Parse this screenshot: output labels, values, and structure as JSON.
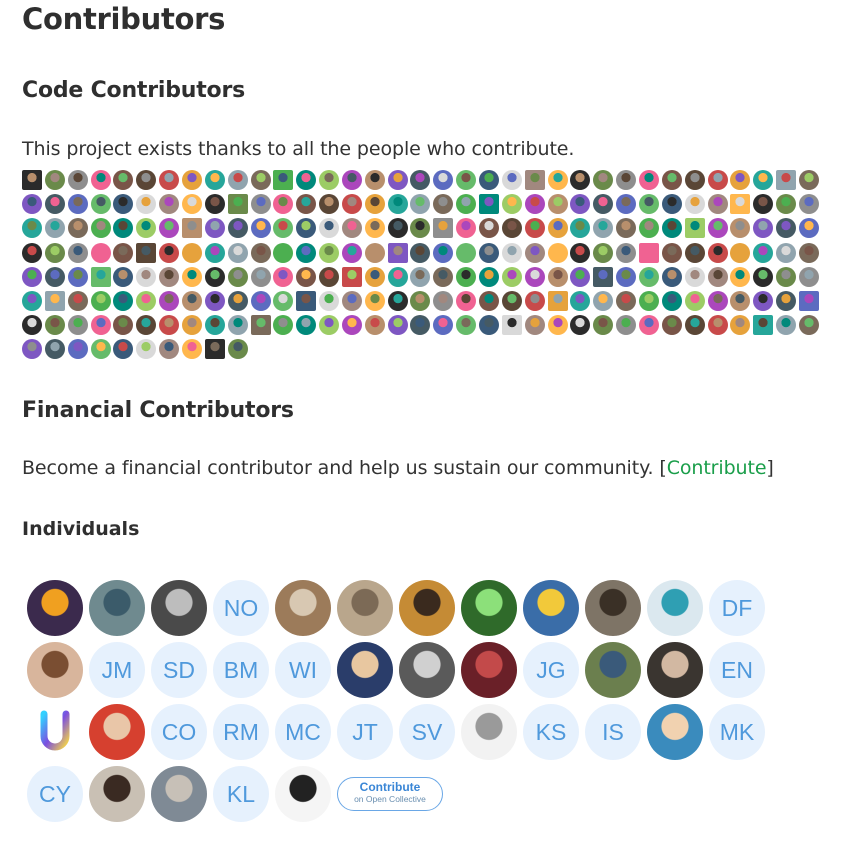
{
  "page": {
    "title": "Contributors",
    "code_section": {
      "heading": "Code Contributors",
      "text": "This project exists thanks to all the people who contribute."
    },
    "financial_section": {
      "heading": "Financial Contributors",
      "text_before": "Become a financial contributor and help us sustain our community. [",
      "link_label": "Contribute",
      "text_after": "]"
    },
    "individuals_heading": "Individuals"
  },
  "code_contributors_count": 255,
  "backers": [
    {
      "kind": "photo",
      "color": "#3b2a4d",
      "accent": "#f0a020"
    },
    {
      "kind": "photo",
      "color": "#6f8a8f",
      "accent": "#3b5b6a"
    },
    {
      "kind": "photo",
      "color": "#4a4a4a",
      "accent": "#bdbdbd"
    },
    {
      "kind": "initials",
      "label": "NO"
    },
    {
      "kind": "photo",
      "color": "#9c7b5a",
      "accent": "#d8c8b2"
    },
    {
      "kind": "photo",
      "color": "#b9a68c",
      "accent": "#7c6a56"
    },
    {
      "kind": "photo",
      "color": "#c58b35",
      "accent": "#3a2a1e"
    },
    {
      "kind": "photo",
      "color": "#2f6a2a",
      "accent": "#8ce07a"
    },
    {
      "kind": "photo",
      "color": "#3a6da8",
      "accent": "#f2c93a"
    },
    {
      "kind": "photo",
      "color": "#7e7466",
      "accent": "#3a3026"
    },
    {
      "kind": "photo",
      "color": "#dbe8ef",
      "accent": "#2f9fb3"
    },
    {
      "kind": "initials",
      "label": "DF"
    },
    {
      "kind": "photo",
      "color": "#d8b59c",
      "accent": "#7a4e32"
    },
    {
      "kind": "initials",
      "label": "JM"
    },
    {
      "kind": "initials",
      "label": "SD"
    },
    {
      "kind": "initials",
      "label": "BM"
    },
    {
      "kind": "initials",
      "label": "WI"
    },
    {
      "kind": "photo",
      "color": "#2a3d6a",
      "accent": "#e8c7a0"
    },
    {
      "kind": "photo",
      "color": "#5a5a5a",
      "accent": "#d0d0d0"
    },
    {
      "kind": "photo",
      "color": "#6a2028",
      "accent": "#c34a4a"
    },
    {
      "kind": "initials",
      "label": "JG"
    },
    {
      "kind": "photo",
      "color": "#6b7f4e",
      "accent": "#3a5a7a"
    },
    {
      "kind": "photo",
      "color": "#3a3530",
      "accent": "#d2b8a2"
    },
    {
      "kind": "initials",
      "label": "EN"
    },
    {
      "kind": "logo-u",
      "color": "#ffffff",
      "accent": "#7b4ee0"
    },
    {
      "kind": "photo",
      "color": "#d6402f",
      "accent": "#e9c6a8"
    },
    {
      "kind": "initials",
      "label": "CO"
    },
    {
      "kind": "initials",
      "label": "RM"
    },
    {
      "kind": "initials",
      "label": "MC"
    },
    {
      "kind": "initials",
      "label": "JT"
    },
    {
      "kind": "initials",
      "label": "SV"
    },
    {
      "kind": "photo",
      "color": "#f2f2f2",
      "accent": "#9a9a9a"
    },
    {
      "kind": "initials",
      "label": "KS"
    },
    {
      "kind": "initials",
      "label": "IS"
    },
    {
      "kind": "photo",
      "color": "#3a8bbd",
      "accent": "#f1d2b0"
    },
    {
      "kind": "initials",
      "label": "MK"
    },
    {
      "kind": "initials",
      "label": "CY"
    },
    {
      "kind": "photo",
      "color": "#c9c0b4",
      "accent": "#3a2a22"
    },
    {
      "kind": "photo",
      "color": "#7f8a95",
      "accent": "#c7c0b7"
    },
    {
      "kind": "initials",
      "label": "KL"
    },
    {
      "kind": "photo",
      "color": "#f5f5f5",
      "accent": "#222222"
    }
  ],
  "contribute_button": {
    "label": "Contribute",
    "sublabel": "on Open Collective"
  }
}
